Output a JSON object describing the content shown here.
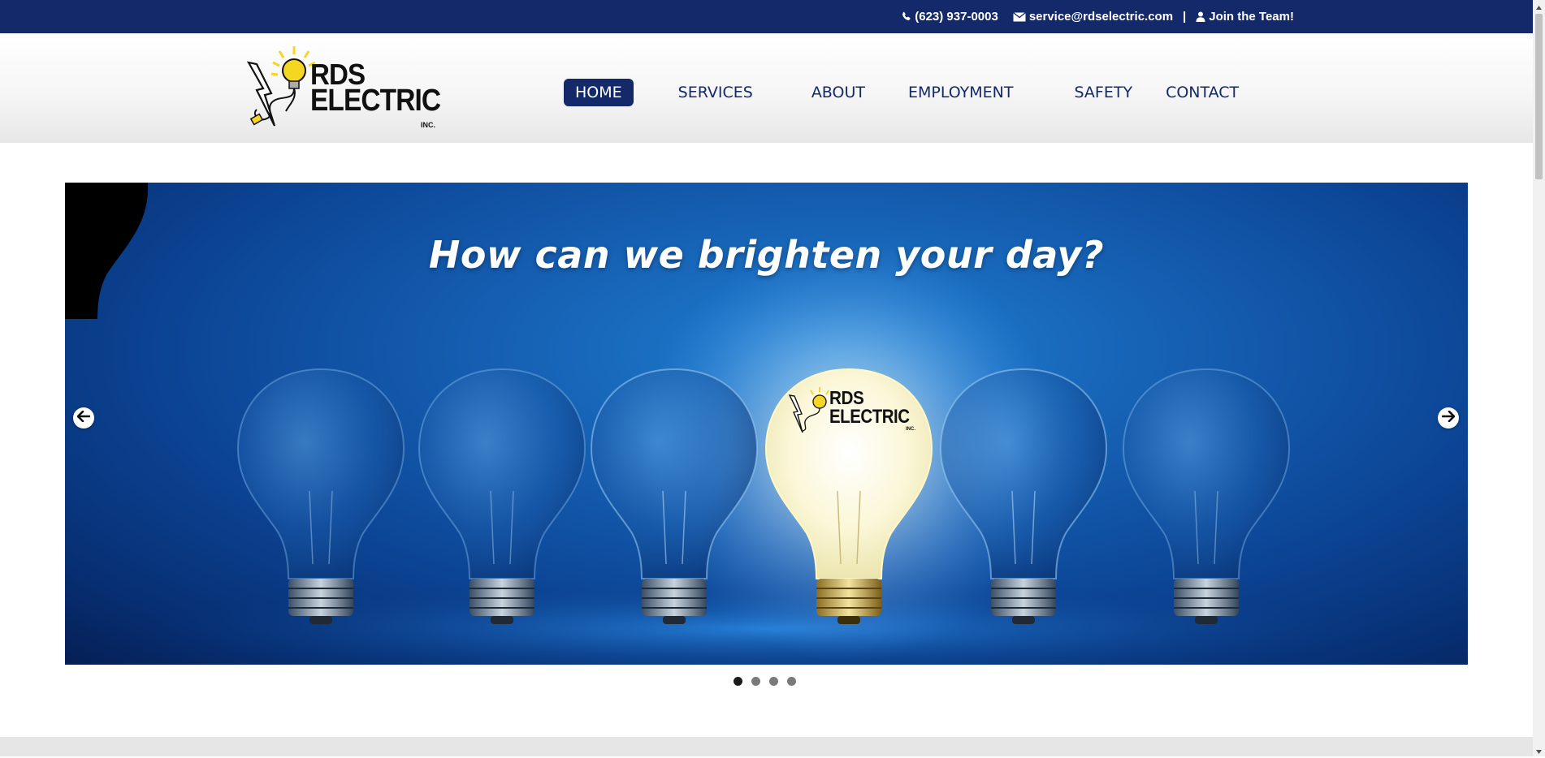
{
  "topbar": {
    "phone": "(623) 937-0003",
    "email": "service@rdselectric.com",
    "separator": "|",
    "join": "Join the Team!",
    "icons": [
      "phone-icon",
      "envelope-icon",
      "user-icon"
    ]
  },
  "logo": {
    "line1": "RDS",
    "line2": "ELECTRIC",
    "line3": "INC."
  },
  "nav": {
    "items": [
      {
        "label": "HOME",
        "active": true
      },
      {
        "label": "SERVICES",
        "active": false
      },
      {
        "label": "ABOUT",
        "active": false
      },
      {
        "label": "EMPLOYMENT",
        "active": false
      },
      {
        "label": "SAFETY",
        "active": false
      },
      {
        "label": "CONTACT",
        "active": false
      }
    ]
  },
  "slider": {
    "heading": "How can we brighten your day?",
    "bulb_logo_line1": "RDS",
    "bulb_logo_line2": "ELECTRIC",
    "bulb_logo_line3": "INC.",
    "slide_count": 4,
    "active_slide": 1,
    "prev_icon": "arrow-left-icon",
    "next_icon": "arrow-right-icon"
  },
  "colors": {
    "brand_navy": "#13296a",
    "accent_yellow": "#f5d623"
  }
}
